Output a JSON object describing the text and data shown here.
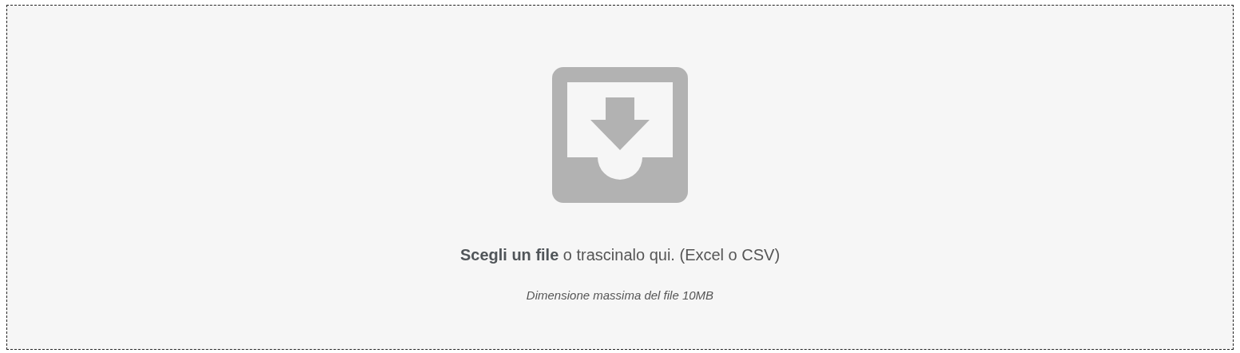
{
  "dropzone": {
    "prompt": "**Scegli un file** o trascinalo qui. (Excel o CSV)",
    "note": "Dimensione massima del file 10MB"
  }
}
